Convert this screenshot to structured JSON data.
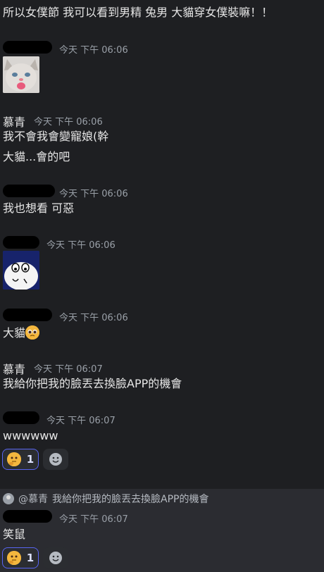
{
  "messages": [
    {
      "type": "text",
      "text": "所以女僕節 我可以看到男精 兔男 大貓穿女僕裝嘛！！"
    },
    {
      "type": "header",
      "author": "",
      "stub": "",
      "timestamp": "今天 下午 06:06"
    },
    {
      "type": "sticker",
      "name": "cat-sticker"
    },
    {
      "type": "header",
      "author": "慕青",
      "timestamp": "今天 下午 06:06"
    },
    {
      "type": "text",
      "text": "我不會我會變寵娘(幹"
    },
    {
      "type": "text",
      "text": "大貓...會的吧"
    },
    {
      "type": "header",
      "author": "",
      "stub": "",
      "timestamp": "今天 下午 06:06"
    },
    {
      "type": "text",
      "text": "我也想看 可惡"
    },
    {
      "type": "header",
      "author": "",
      "stub": "",
      "timestamp": "今天 下午 06:06"
    },
    {
      "type": "sticker",
      "name": "crying-sticker"
    },
    {
      "type": "header",
      "author": "",
      "stub": "",
      "timestamp": "今天 下午 06:06"
    },
    {
      "type": "text",
      "text": "大貓"
    },
    {
      "type": "header",
      "author": "慕青",
      "timestamp": "今天 下午 06:07"
    },
    {
      "type": "text",
      "text": "我給你把我的臉丟去換臉APP的機會"
    },
    {
      "type": "header",
      "author": "",
      "stub": "",
      "timestamp": "今天 下午 06:07"
    },
    {
      "type": "text",
      "text": "wwwwww"
    },
    {
      "type": "reaction",
      "count": "1"
    },
    {
      "type": "reply",
      "mention": "@慕青",
      "quoted": "我給你把我的臉丟去換臉APP的機會"
    },
    {
      "type": "header",
      "author": "",
      "stub": "",
      "timestamp": "今天 下午 06:07"
    },
    {
      "type": "text",
      "text": "笑鼠"
    },
    {
      "type": "reaction",
      "count": "1"
    }
  ],
  "colors": {
    "background": "#1e1f22",
    "reply_background": "#2b2c31",
    "reaction_border": "#5865f2"
  }
}
